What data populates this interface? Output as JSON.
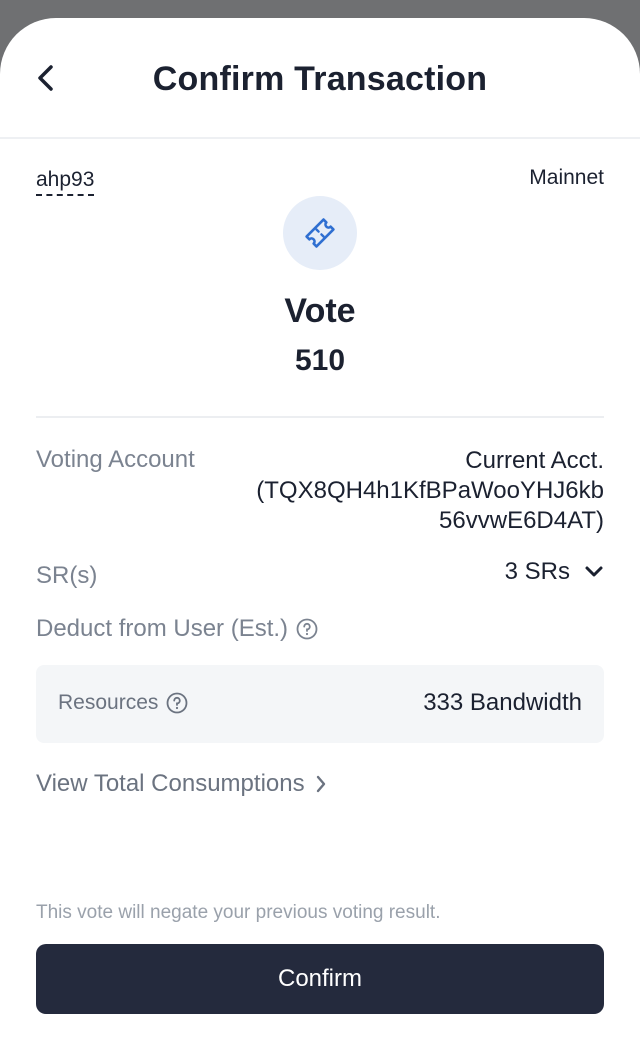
{
  "header": {
    "title": "Confirm Transaction",
    "back_icon": "chevron-left-icon"
  },
  "account": {
    "name": "ahp93",
    "network": "Mainnet"
  },
  "action": {
    "icon": "ticket-icon",
    "title": "Vote",
    "amount": "510"
  },
  "details": {
    "voting_account_label": "Voting Account",
    "voting_account_line1": "Current Acct.",
    "voting_account_line2": "(TQX8QH4h1KfBPaWooYHJ6kb",
    "voting_account_line3": "56vvwE6D4AT)",
    "sr_label": "SR(s)",
    "sr_value": "3 SRs",
    "deduct_label": "Deduct from User (Est.)",
    "resources_label": "Resources",
    "resources_value": "333 Bandwidth",
    "view_total_label": "View Total Consumptions"
  },
  "footer": {
    "note": "This vote will negate your previous voting result.",
    "confirm_label": "Confirm"
  },
  "colors": {
    "primary_dark": "#242a3d",
    "icon_bg": "#e6edf8",
    "icon_accent": "#2f6fd1",
    "muted_text": "#7b8390"
  }
}
